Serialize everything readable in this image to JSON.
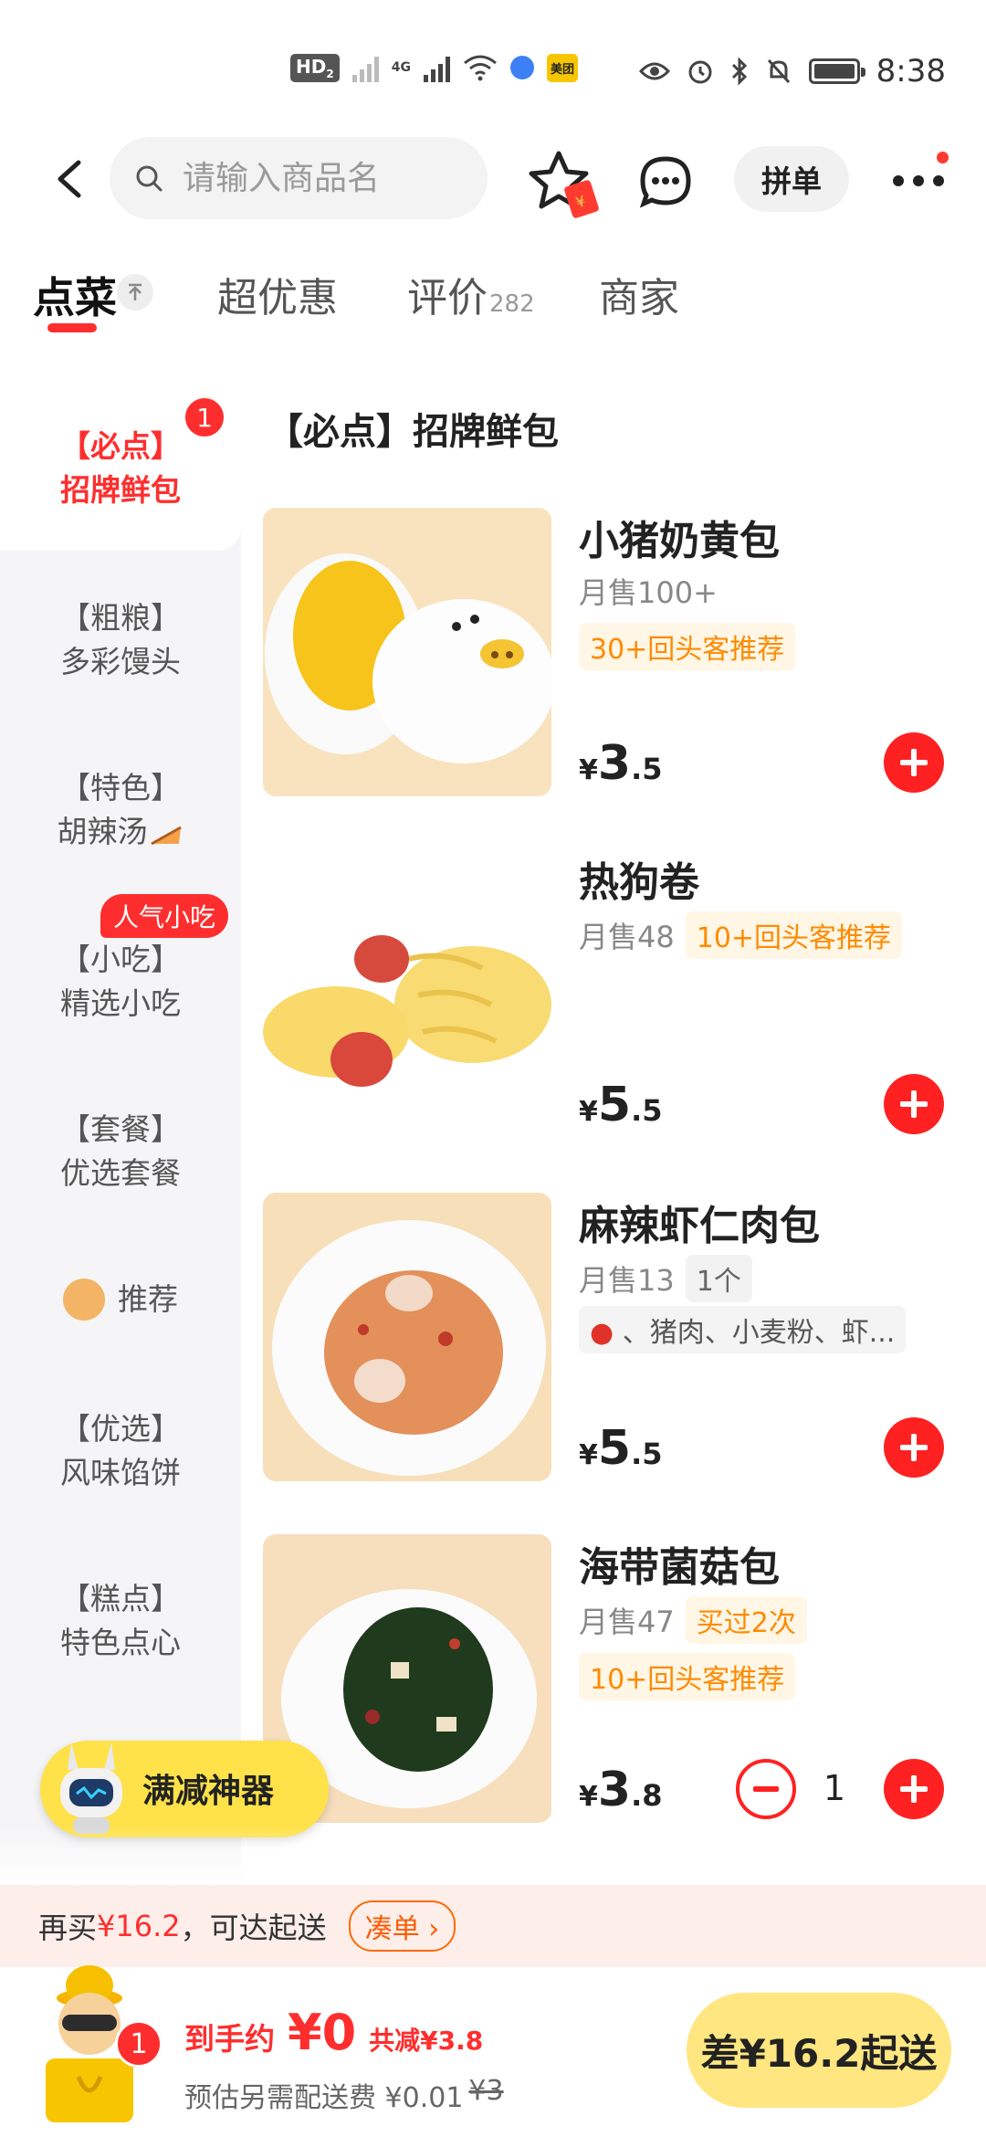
{
  "status_bar": {
    "hd_label": "HD",
    "hd_sub": "2",
    "net_label": "4G",
    "app_badge": "美团",
    "time": "8:38"
  },
  "header": {
    "search_placeholder": "请输入商品名",
    "pindan_label": "拼单"
  },
  "tabs": [
    {
      "label": "点菜",
      "active": true
    },
    {
      "label": "超优惠"
    },
    {
      "label": "评价",
      "count": "282"
    },
    {
      "label": "商家"
    }
  ],
  "sidebar": {
    "items": [
      {
        "line1": "【必点】",
        "line2": "招牌鲜包",
        "badge": "1"
      },
      {
        "line1": "【粗粮】",
        "line2": "多彩馒头"
      },
      {
        "line1": "【特色】",
        "line2": "胡辣汤"
      },
      {
        "line1": "【小吃】",
        "line2": "精选小吃",
        "tag": "人气小吃"
      },
      {
        "line1": "【套餐】",
        "line2": "优选套餐"
      },
      {
        "line1": "推荐"
      },
      {
        "line1": "【优选】",
        "line2": "风味馅饼"
      },
      {
        "line1": "【糕点】",
        "line2": "特色点心"
      }
    ]
  },
  "section_title": "【必点】招牌鲜包",
  "dishes": [
    {
      "name": "小猪奶黄包",
      "sales": "月售100+",
      "tag": "30+回头客推荐",
      "currency": "¥",
      "price_int": "3",
      "price_dec": ".5"
    },
    {
      "name": "热狗卷",
      "sales": "月售48",
      "tag": "10+回头客推荐",
      "currency": "¥",
      "price_int": "5",
      "price_dec": ".5"
    },
    {
      "name": "麻辣虾仁肉包",
      "sales": "月售13",
      "tag": "1个",
      "ingredients": "、猪肉、小麦粉、虾...",
      "currency": "¥",
      "price_int": "5",
      "price_dec": ".5"
    },
    {
      "name": "海带菌菇包",
      "sales": "月售47",
      "tag": "买过2次",
      "tag2": "10+回头客推荐",
      "currency": "¥",
      "price_int": "3",
      "price_dec": ".8",
      "quantity": "1"
    }
  ],
  "promo": {
    "label": "满减神器"
  },
  "min_order": {
    "prefix": "再买",
    "amount": "¥16.2",
    "suffix": "，可达起送",
    "button": "凑单"
  },
  "cart": {
    "badge": "1",
    "total_label": "到手约",
    "total_value": "¥0",
    "discount": "共减¥3.8",
    "delivery_label": "预估另需配送费 ¥0.01",
    "delivery_original": "¥3",
    "checkout_label": "差¥16.2起送"
  },
  "colors": {
    "accent": "#ff2e2e",
    "promo_yellow": "#ffe14a",
    "tag_orange": "#ff8a00"
  }
}
